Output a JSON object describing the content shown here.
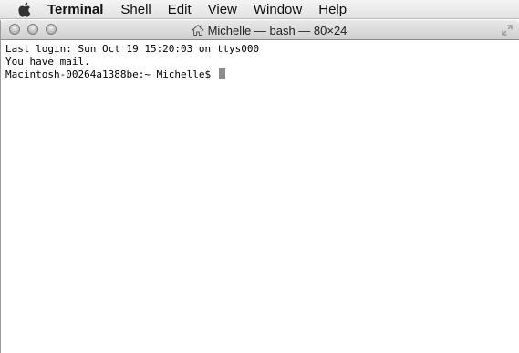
{
  "menubar": {
    "apple_icon": "apple-icon",
    "items": [
      {
        "label": "Terminal"
      },
      {
        "label": "Shell"
      },
      {
        "label": "Edit"
      },
      {
        "label": "View"
      },
      {
        "label": "Window"
      },
      {
        "label": "Help"
      }
    ]
  },
  "window": {
    "title": "Michelle — bash — 80×24",
    "title_icon": "home-icon",
    "traffic_lights": [
      "close-button",
      "minimize-button",
      "zoom-button"
    ]
  },
  "terminal": {
    "lines": [
      "Last login: Sun Oct 19 15:20:03 on ttys000",
      "You have mail.",
      "Macintosh-00264a1388be:~ Michelle$ "
    ],
    "cursor_color": "#8c8c8c"
  }
}
